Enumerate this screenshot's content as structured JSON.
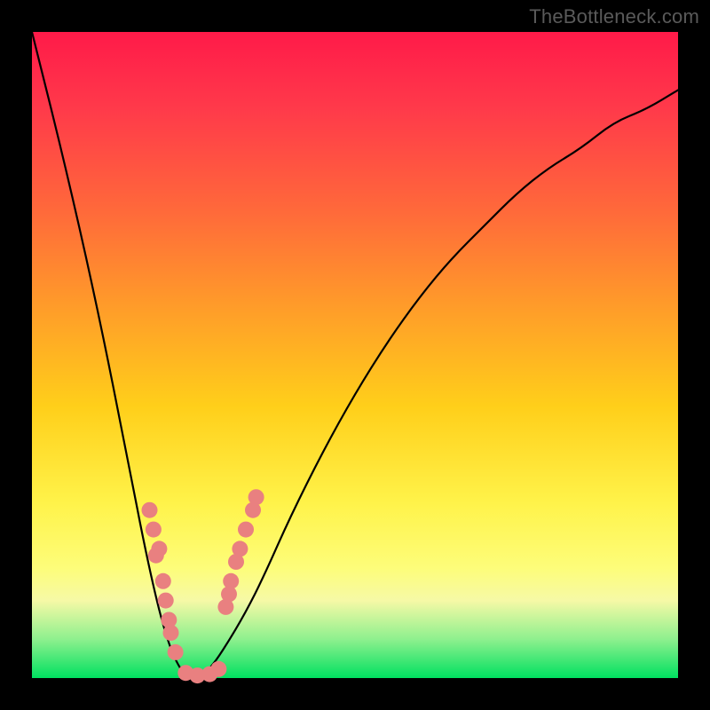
{
  "watermark": "TheBottleneck.com",
  "chart_data": {
    "type": "line",
    "title": "",
    "xlabel": "",
    "ylabel": "",
    "xlim": [
      0,
      1
    ],
    "ylim": [
      0,
      100
    ],
    "note": "V-shaped bottleneck curve; y is approximate bottleneck % read off the color gradient (0 = green bottom, 100 = red top). Data points (dots) cluster near the minimum.",
    "curve": {
      "x": [
        0.0,
        0.05,
        0.1,
        0.15,
        0.175,
        0.2,
        0.22,
        0.24,
        0.26,
        0.28,
        0.3,
        0.33,
        0.36,
        0.4,
        0.45,
        0.5,
        0.55,
        0.6,
        0.65,
        0.7,
        0.75,
        0.8,
        0.85,
        0.9,
        0.95,
        1.0
      ],
      "y": [
        100,
        80,
        58,
        33,
        20,
        9,
        3,
        0,
        0,
        2,
        5,
        10,
        16,
        25,
        35,
        44,
        52,
        59,
        65,
        70,
        75,
        79,
        82,
        86,
        88,
        91
      ]
    },
    "series": [
      {
        "name": "left-branch-dots",
        "x": [
          0.182,
          0.188,
          0.197,
          0.192,
          0.203,
          0.207,
          0.212,
          0.215,
          0.222
        ],
        "y": [
          26,
          23,
          20,
          19,
          15,
          12,
          9,
          7,
          4
        ]
      },
      {
        "name": "right-branch-dots",
        "x": [
          0.3,
          0.305,
          0.308,
          0.316,
          0.322,
          0.331,
          0.342,
          0.347
        ],
        "y": [
          11,
          13,
          15,
          18,
          20,
          23,
          26,
          28
        ]
      },
      {
        "name": "trough-dots",
        "x": [
          0.238,
          0.256,
          0.275,
          0.289
        ],
        "y": [
          0.8,
          0.4,
          0.6,
          1.4
        ]
      }
    ],
    "colors": {
      "curve": "#000000",
      "dots": "#e98080",
      "gradient_top": "#ff1a49",
      "gradient_bottom": "#00e060",
      "frame": "#000000"
    }
  }
}
